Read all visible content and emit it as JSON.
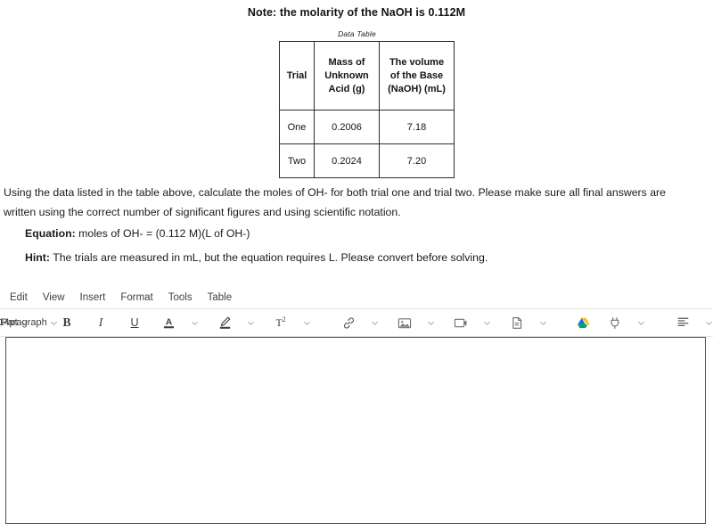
{
  "question": {
    "note": "Note: the molarity of the NaOH is 0.112M",
    "table_caption": "Data Table",
    "table": {
      "headers": [
        "Trial",
        "Mass of Unknown Acid (g)",
        "The volume of the Base (NaOH) (mL)"
      ],
      "header_lines": [
        [
          "Trial"
        ],
        [
          "Mass of",
          "Unknown",
          "Acid (g)"
        ],
        [
          "The volume",
          "of the Base",
          "(NaOH) (mL)"
        ]
      ],
      "rows": [
        [
          "One",
          "0.2006",
          "7.18"
        ],
        [
          "Two",
          "0.2024",
          "7.20"
        ]
      ]
    },
    "prompt": "Using the data listed in the table above, calculate the moles of OH- for both trial one and trial two. Please make sure all final answers are written using the correct number of significant figures and using scientific notation.",
    "equation_label": "Equation:",
    "equation_text": " moles of OH- = (0.112 M)(L of OH-)",
    "hint_label": "Hint:",
    "hint_text": " The trials are measured in mL, but the equation requires L. Please convert before solving."
  },
  "editor": {
    "menu": [
      {
        "label": "Edit",
        "name": "menu-edit"
      },
      {
        "label": "View",
        "name": "menu-view"
      },
      {
        "label": "Insert",
        "name": "menu-insert"
      },
      {
        "label": "Format",
        "name": "menu-format"
      },
      {
        "label": "Tools",
        "name": "menu-tools"
      },
      {
        "label": "Table",
        "name": "menu-table"
      }
    ],
    "toolbar": {
      "font_size": "14pt",
      "block_format": "Paragraph",
      "bold": "B",
      "italic": "I",
      "underline": "U",
      "text_color": "A",
      "superscript": "T",
      "superscript_exp": "2"
    },
    "content_value": "",
    "colors": {
      "drive_blue": "#1a73e8",
      "drive_green": "#00ac47",
      "drive_yellow": "#ffba00",
      "icon_gray": "#4a4f55",
      "caret_gray": "#9aa0a6",
      "border": "#4a4f55"
    }
  }
}
